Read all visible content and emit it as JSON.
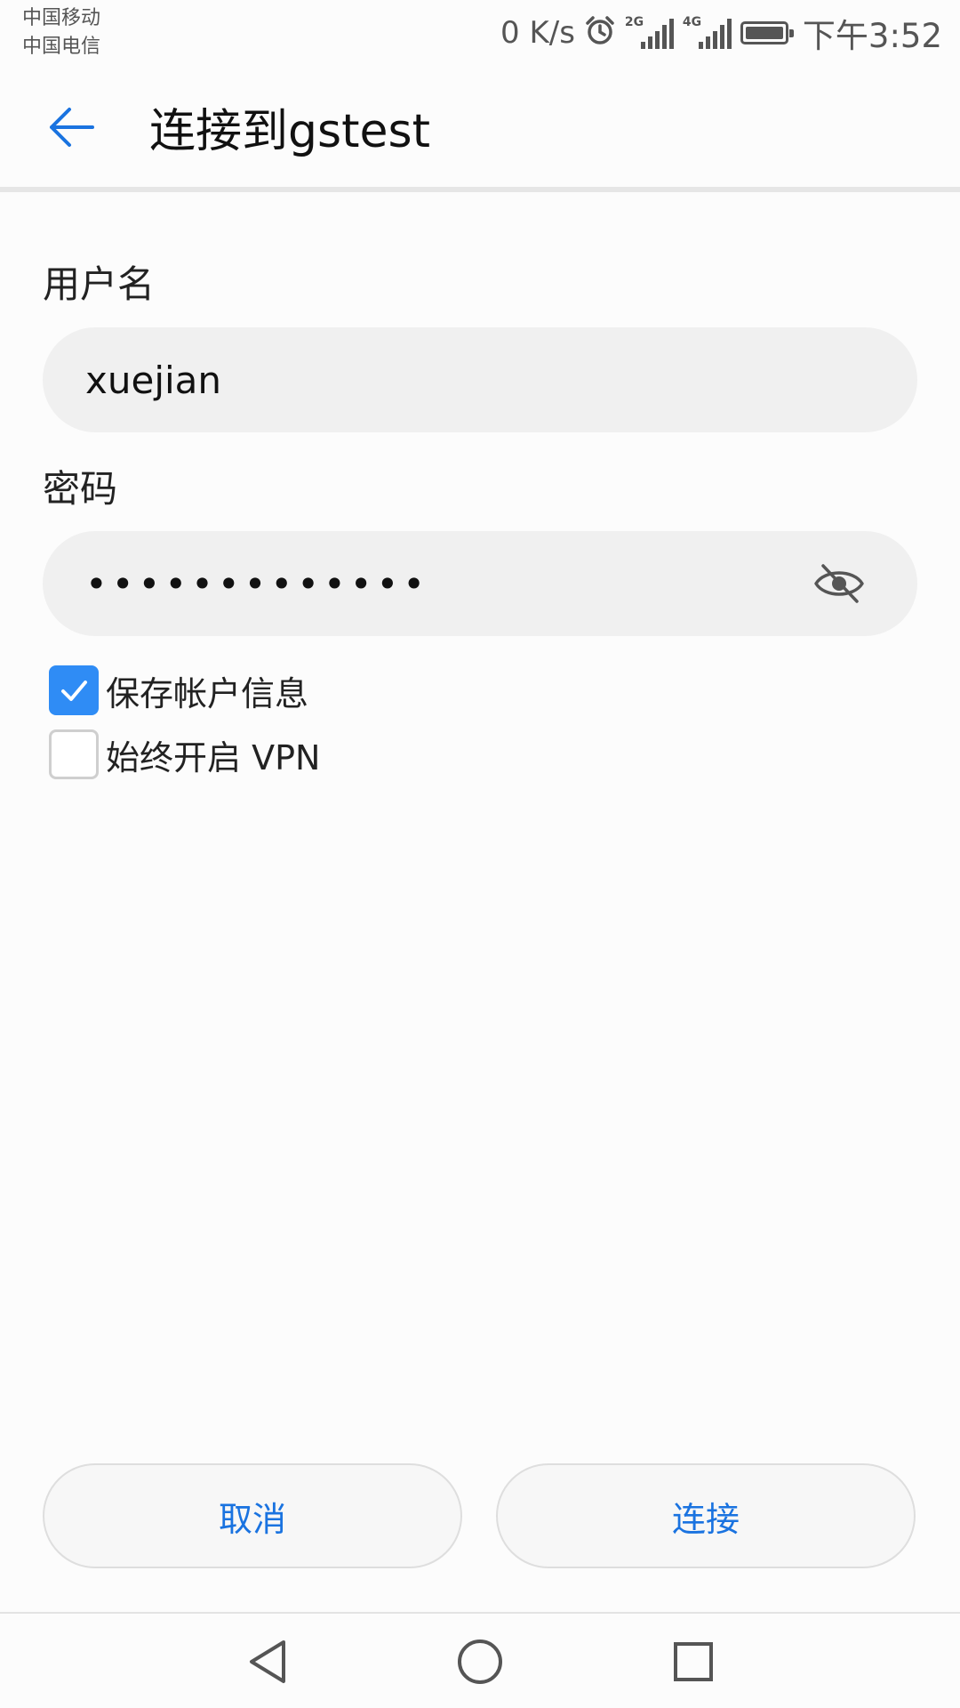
{
  "status_bar": {
    "carrier_1": "中国移动",
    "carrier_2": "中国电信",
    "net_speed": "0 K/s",
    "sim1_label": "2G",
    "sim2_label": "4G",
    "time": "下午3:52",
    "icons": [
      "alarm-icon",
      "signal-icon",
      "signal-icon",
      "battery-icon"
    ]
  },
  "header": {
    "title": "连接到gstest",
    "back_icon": "back-arrow-icon"
  },
  "form": {
    "username_label": "用户名",
    "username_value": "xuejian",
    "password_label": "密码",
    "password_masked": "•••••••••••••",
    "password_toggle_icon": "eye-off-icon",
    "save_account": {
      "label": "保存帐户信息",
      "checked": true
    },
    "always_on_vpn": {
      "label": "始终开启 VPN",
      "checked": false
    }
  },
  "actions": {
    "cancel_label": "取消",
    "connect_label": "连接"
  },
  "nav_bar": {
    "icons": [
      "back-triangle-icon",
      "home-circle-icon",
      "recents-square-icon"
    ]
  },
  "colors": {
    "accent": "#2f8cf5",
    "button_text": "#1a73e0",
    "field_bg": "#f0f0f0",
    "page_bg": "#fcfcfc"
  }
}
